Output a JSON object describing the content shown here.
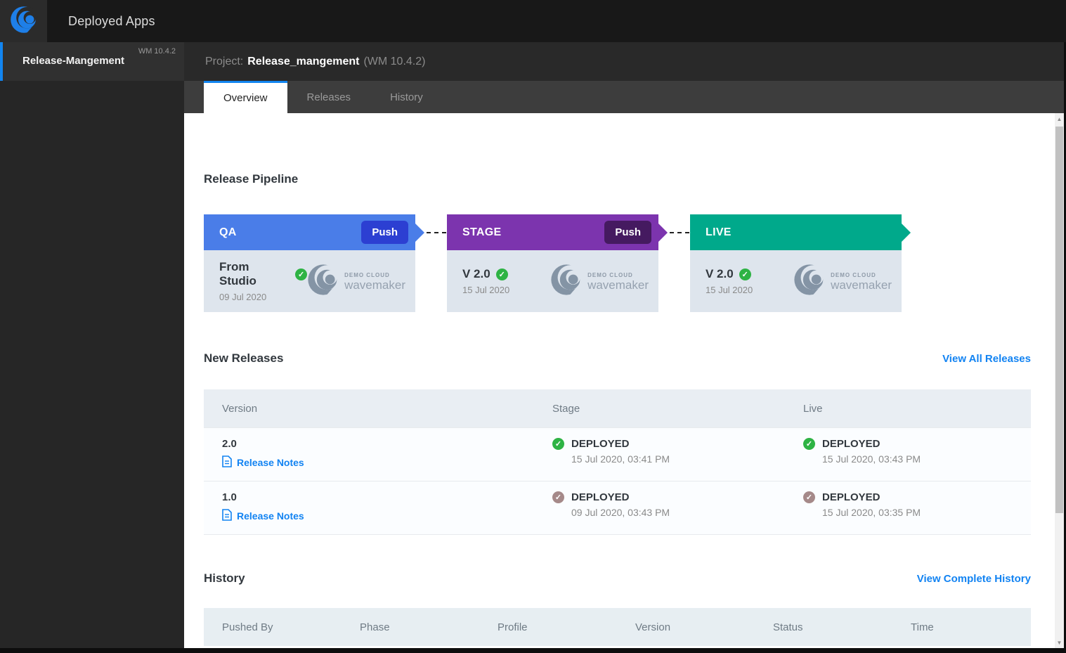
{
  "topbar": {
    "app_title": "Deployed Apps"
  },
  "sidebar": {
    "project_name": "Release-Mangement",
    "project_version": "WM 10.4.2"
  },
  "project_header": {
    "label": "Project:",
    "name": "Release_mangement",
    "version": "(WM 10.4.2)"
  },
  "tabs": [
    {
      "label": "Overview",
      "active": true
    },
    {
      "label": "Releases",
      "active": false
    },
    {
      "label": "History",
      "active": false
    }
  ],
  "brand": {
    "cloud_label": "DEMO CLOUD",
    "brand_name": "wavemaker"
  },
  "pipeline": {
    "title": "Release Pipeline",
    "stages": [
      {
        "name": "QA",
        "push_label": "Push",
        "version": "From Studio",
        "date": "09 Jul 2020",
        "header_color": "#4a7de8",
        "push_color": "#2c3fd2",
        "check_color": "#2eb344"
      },
      {
        "name": "STAGE",
        "push_label": "Push",
        "version": "V 2.0",
        "date": "15 Jul 2020",
        "header_color": "#7c34ae",
        "push_color": "#451a60",
        "check_color": "#2eb344"
      },
      {
        "name": "LIVE",
        "version": "V 2.0",
        "date": "15 Jul 2020",
        "header_color": "#00a98b",
        "check_color": "#2eb344"
      }
    ]
  },
  "new_releases": {
    "title": "New Releases",
    "view_all_label": "View All Releases",
    "release_notes_label": "Release Notes",
    "columns": [
      "Version",
      "Stage",
      "Live"
    ],
    "rows": [
      {
        "version": "2.0",
        "stage": {
          "status": "DEPLOYED",
          "time": "15 Jul 2020, 03:41 PM",
          "check_color": "#2eb344"
        },
        "live": {
          "status": "DEPLOYED",
          "time": "15 Jul 2020, 03:43 PM",
          "check_color": "#2eb344"
        }
      },
      {
        "version": "1.0",
        "stage": {
          "status": "DEPLOYED",
          "time": "09 Jul 2020, 03:43 PM",
          "check_color": "#a58989"
        },
        "live": {
          "status": "DEPLOYED",
          "time": "15 Jul 2020, 03:35 PM",
          "check_color": "#a58989"
        }
      }
    ]
  },
  "history": {
    "title": "History",
    "view_all_label": "View Complete History",
    "columns": [
      "Pushed By",
      "Phase",
      "Profile",
      "Version",
      "Status",
      "Time"
    ]
  },
  "icons": {
    "check": "✓",
    "arrow_up": "▲",
    "arrow_down": "▼"
  },
  "colors": {
    "accent_blue": "#1285f0",
    "link_blue": "#1283f2",
    "brand_blue": "#1e7fe8"
  }
}
